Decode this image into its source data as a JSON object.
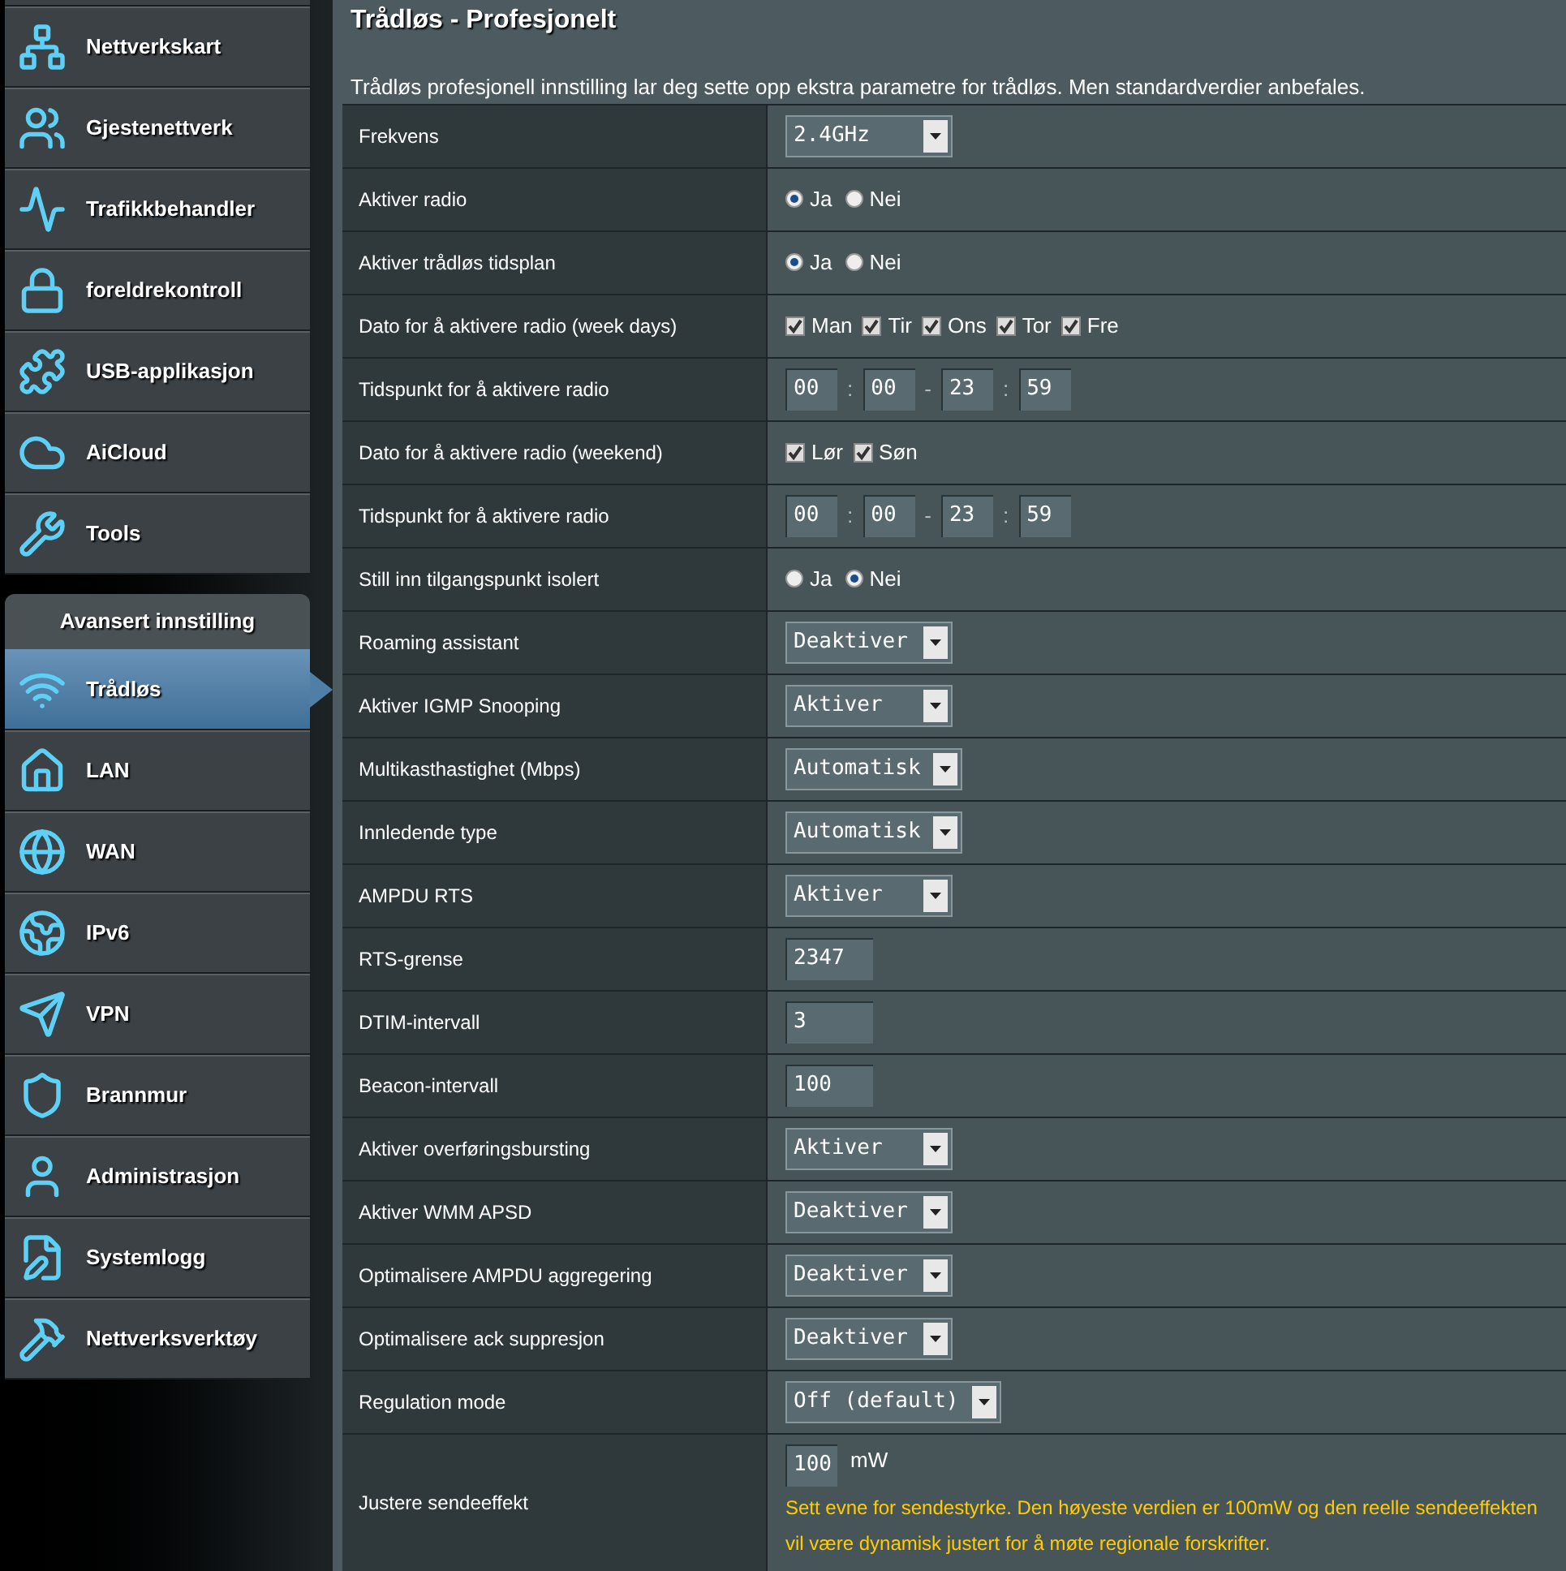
{
  "sidebar": {
    "items": [
      {
        "label": "Nettverkskart",
        "selected": false
      },
      {
        "label": "Gjestenettverk",
        "selected": false
      },
      {
        "label": "Trafikkbehandler",
        "selected": false
      },
      {
        "label": "foreldrekontroll",
        "selected": false
      },
      {
        "label": "USB-applikasjon",
        "selected": false
      },
      {
        "label": "AiCloud",
        "selected": false
      },
      {
        "label": "Tools",
        "selected": false
      }
    ],
    "section_title": "Avansert innstilling",
    "advanced_items": [
      {
        "label": "Trådløs",
        "selected": true
      },
      {
        "label": "LAN",
        "selected": false
      },
      {
        "label": "WAN",
        "selected": false
      },
      {
        "label": "IPv6",
        "selected": false
      },
      {
        "label": "VPN",
        "selected": false
      },
      {
        "label": "Brannmur",
        "selected": false
      },
      {
        "label": "Administrasjon",
        "selected": false
      },
      {
        "label": "Systemlogg",
        "selected": false
      },
      {
        "label": "Nettverksverktøy",
        "selected": false
      }
    ]
  },
  "page": {
    "title": "Trådløs - Profesjonelt",
    "description": "Trådløs profesjonell innstilling lar deg sette opp ekstra parametre for trådløs. Men standardverdier anbefales."
  },
  "settings": [
    {
      "label": "Frekvens",
      "kind": "select",
      "value": "2.4GHz"
    },
    {
      "label": "Aktiver radio",
      "kind": "radio",
      "options": [
        {
          "label": "Ja",
          "selected": true
        },
        {
          "label": "Nei",
          "selected": false
        }
      ]
    },
    {
      "label": "Aktiver trådløs tidsplan",
      "kind": "radio",
      "options": [
        {
          "label": "Ja",
          "selected": true
        },
        {
          "label": "Nei",
          "selected": false
        }
      ]
    },
    {
      "label": "Dato for å aktivere radio (week days)",
      "kind": "checkbox",
      "options": [
        {
          "label": "Man",
          "checked": true
        },
        {
          "label": "Tir",
          "checked": true
        },
        {
          "label": "Ons",
          "checked": true
        },
        {
          "label": "Tor",
          "checked": true
        },
        {
          "label": "Fre",
          "checked": true
        }
      ]
    },
    {
      "label": "Tidspunkt for å aktivere radio",
      "kind": "time",
      "fields": [
        "00",
        "00",
        "23",
        "59"
      ],
      "separators": [
        ":",
        "-",
        ":"
      ]
    },
    {
      "label": "Dato for å aktivere radio (weekend)",
      "kind": "checkbox",
      "options": [
        {
          "label": "Lør",
          "checked": true
        },
        {
          "label": "Søn",
          "checked": true
        }
      ]
    },
    {
      "label": "Tidspunkt for å aktivere radio",
      "kind": "time",
      "fields": [
        "00",
        "00",
        "23",
        "59"
      ],
      "separators": [
        ":",
        "-",
        ":"
      ]
    },
    {
      "label": "Still inn tilgangspunkt isolert",
      "kind": "radio",
      "options": [
        {
          "label": "Ja",
          "selected": false
        },
        {
          "label": "Nei",
          "selected": true
        }
      ]
    },
    {
      "label": "Roaming assistant",
      "kind": "select",
      "value": "Deaktiver"
    },
    {
      "label": "Aktiver IGMP Snooping",
      "kind": "select",
      "value": "Aktiver"
    },
    {
      "label": "Multikasthastighet (Mbps)",
      "kind": "select",
      "value": "Automatisk"
    },
    {
      "label": "Innledende type",
      "kind": "select",
      "value": "Automatisk"
    },
    {
      "label": "AMPDU RTS",
      "kind": "select",
      "value": "Aktiver"
    },
    {
      "label": "RTS-grense",
      "kind": "text",
      "value": "2347"
    },
    {
      "label": "DTIM-intervall",
      "kind": "text",
      "value": "3"
    },
    {
      "label": "Beacon-intervall",
      "kind": "text",
      "value": "100"
    },
    {
      "label": "Aktiver overføringsbursting",
      "kind": "select",
      "value": "Aktiver"
    },
    {
      "label": "Aktiver WMM APSD",
      "kind": "select",
      "value": "Deaktiver"
    },
    {
      "label": "Optimalisere AMPDU aggregering",
      "kind": "select",
      "value": "Deaktiver"
    },
    {
      "label": "Optimalisere ack suppresjon",
      "kind": "select",
      "value": "Deaktiver"
    },
    {
      "label": "Regulation mode",
      "kind": "select",
      "value": "Off (default)"
    },
    {
      "label": "Justere sendeeffekt",
      "kind": "power",
      "value": "100",
      "unit": "mW",
      "note": "Sett evne for sendestyrke. Den høyeste verdien er 100mW og den reelle sendeeffekten vil være dynamisk justert for å møte regionale forskrifter."
    }
  ]
}
